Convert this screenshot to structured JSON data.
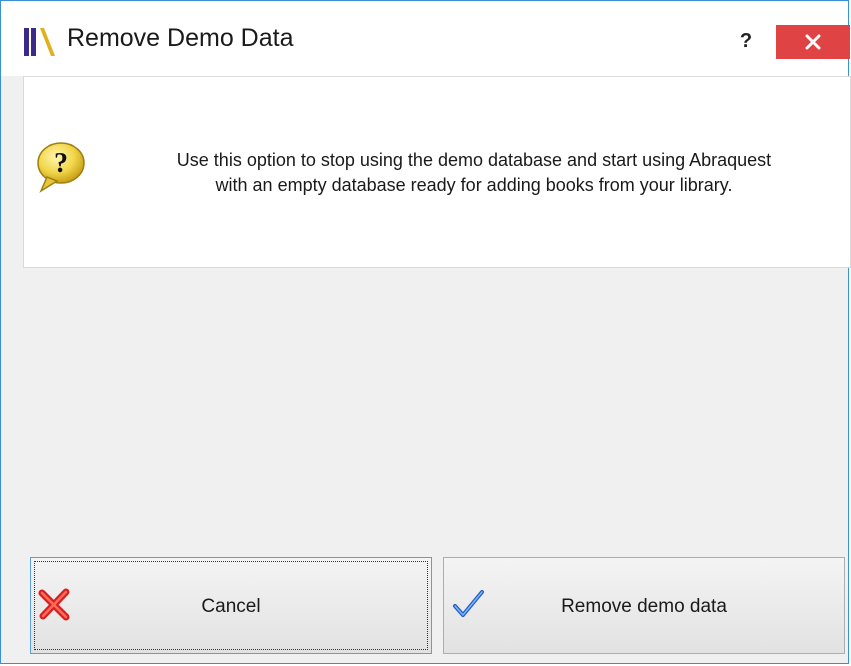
{
  "window": {
    "title": "Remove Demo Data",
    "help_label": "?",
    "accent_color": "#3a8fd8",
    "close_color": "#e04343"
  },
  "message": {
    "line1": "Use this option to stop using the demo database and start using Abraquest",
    "line2": "with an empty database ready for adding books from your library.",
    "icon": "question-balloon-icon"
  },
  "buttons": {
    "cancel": {
      "label": "Cancel",
      "icon": "red-x-icon"
    },
    "remove": {
      "label": "Remove demo data",
      "icon": "blue-checkmark-icon"
    }
  }
}
